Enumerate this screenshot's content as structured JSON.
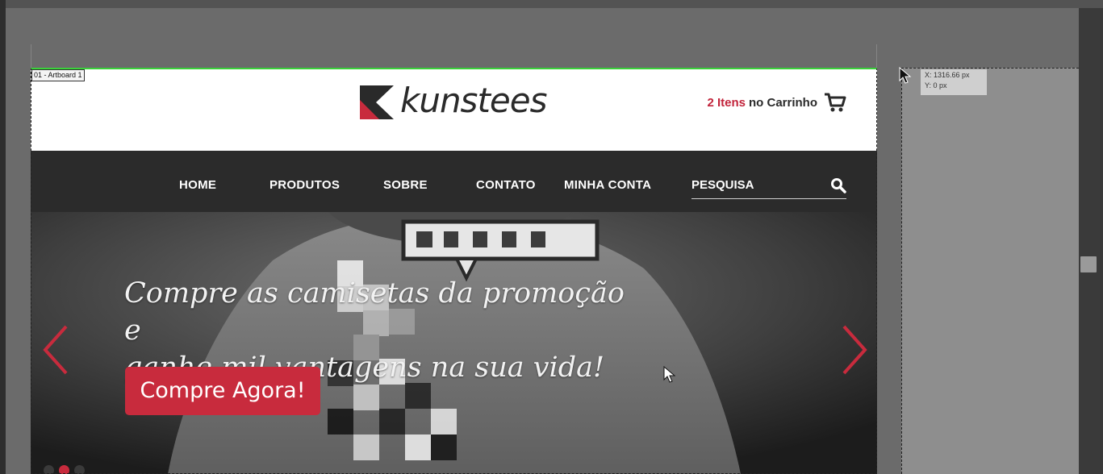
{
  "artboard": {
    "label": "01 - Artboard 1"
  },
  "tooltip": {
    "x": "X: 1316.66 px",
    "y": "Y: 0 px"
  },
  "site": {
    "brand": "kunstees",
    "cart": {
      "count": "2 Itens",
      "suffix": "no Carrinho"
    },
    "nav": [
      "HOME",
      "PRODUTOS",
      "SOBRE",
      "CONTATO",
      "MINHA CONTA"
    ],
    "search_label": "PESQUISA",
    "hero": {
      "line1": "Compre as camisetas da promoção e",
      "line2": "ganhe mil vantagens na sua vida!",
      "cta": "Compre Agora!"
    }
  },
  "colors": {
    "accent": "#c82b3d",
    "nav_bg": "#2b2b2b",
    "logo_dark": "#2a2a2a"
  },
  "icons": [
    "logo-mark-icon",
    "cart-icon",
    "search-icon",
    "arrow-left-icon",
    "arrow-right-icon",
    "mouse-cursor-icon"
  ]
}
